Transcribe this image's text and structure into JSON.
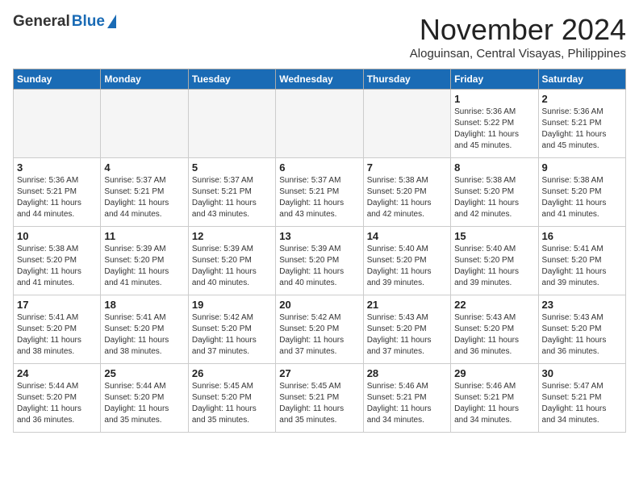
{
  "logo": {
    "general": "General",
    "blue": "Blue"
  },
  "header": {
    "month": "November 2024",
    "location": "Aloguinsan, Central Visayas, Philippines"
  },
  "weekdays": [
    "Sunday",
    "Monday",
    "Tuesday",
    "Wednesday",
    "Thursday",
    "Friday",
    "Saturday"
  ],
  "weeks": [
    [
      {
        "day": "",
        "info": ""
      },
      {
        "day": "",
        "info": ""
      },
      {
        "day": "",
        "info": ""
      },
      {
        "day": "",
        "info": ""
      },
      {
        "day": "",
        "info": ""
      },
      {
        "day": "1",
        "info": "Sunrise: 5:36 AM\nSunset: 5:22 PM\nDaylight: 11 hours\nand 45 minutes."
      },
      {
        "day": "2",
        "info": "Sunrise: 5:36 AM\nSunset: 5:21 PM\nDaylight: 11 hours\nand 45 minutes."
      }
    ],
    [
      {
        "day": "3",
        "info": "Sunrise: 5:36 AM\nSunset: 5:21 PM\nDaylight: 11 hours\nand 44 minutes."
      },
      {
        "day": "4",
        "info": "Sunrise: 5:37 AM\nSunset: 5:21 PM\nDaylight: 11 hours\nand 44 minutes."
      },
      {
        "day": "5",
        "info": "Sunrise: 5:37 AM\nSunset: 5:21 PM\nDaylight: 11 hours\nand 43 minutes."
      },
      {
        "day": "6",
        "info": "Sunrise: 5:37 AM\nSunset: 5:21 PM\nDaylight: 11 hours\nand 43 minutes."
      },
      {
        "day": "7",
        "info": "Sunrise: 5:38 AM\nSunset: 5:20 PM\nDaylight: 11 hours\nand 42 minutes."
      },
      {
        "day": "8",
        "info": "Sunrise: 5:38 AM\nSunset: 5:20 PM\nDaylight: 11 hours\nand 42 minutes."
      },
      {
        "day": "9",
        "info": "Sunrise: 5:38 AM\nSunset: 5:20 PM\nDaylight: 11 hours\nand 41 minutes."
      }
    ],
    [
      {
        "day": "10",
        "info": "Sunrise: 5:38 AM\nSunset: 5:20 PM\nDaylight: 11 hours\nand 41 minutes."
      },
      {
        "day": "11",
        "info": "Sunrise: 5:39 AM\nSunset: 5:20 PM\nDaylight: 11 hours\nand 41 minutes."
      },
      {
        "day": "12",
        "info": "Sunrise: 5:39 AM\nSunset: 5:20 PM\nDaylight: 11 hours\nand 40 minutes."
      },
      {
        "day": "13",
        "info": "Sunrise: 5:39 AM\nSunset: 5:20 PM\nDaylight: 11 hours\nand 40 minutes."
      },
      {
        "day": "14",
        "info": "Sunrise: 5:40 AM\nSunset: 5:20 PM\nDaylight: 11 hours\nand 39 minutes."
      },
      {
        "day": "15",
        "info": "Sunrise: 5:40 AM\nSunset: 5:20 PM\nDaylight: 11 hours\nand 39 minutes."
      },
      {
        "day": "16",
        "info": "Sunrise: 5:41 AM\nSunset: 5:20 PM\nDaylight: 11 hours\nand 39 minutes."
      }
    ],
    [
      {
        "day": "17",
        "info": "Sunrise: 5:41 AM\nSunset: 5:20 PM\nDaylight: 11 hours\nand 38 minutes."
      },
      {
        "day": "18",
        "info": "Sunrise: 5:41 AM\nSunset: 5:20 PM\nDaylight: 11 hours\nand 38 minutes."
      },
      {
        "day": "19",
        "info": "Sunrise: 5:42 AM\nSunset: 5:20 PM\nDaylight: 11 hours\nand 37 minutes."
      },
      {
        "day": "20",
        "info": "Sunrise: 5:42 AM\nSunset: 5:20 PM\nDaylight: 11 hours\nand 37 minutes."
      },
      {
        "day": "21",
        "info": "Sunrise: 5:43 AM\nSunset: 5:20 PM\nDaylight: 11 hours\nand 37 minutes."
      },
      {
        "day": "22",
        "info": "Sunrise: 5:43 AM\nSunset: 5:20 PM\nDaylight: 11 hours\nand 36 minutes."
      },
      {
        "day": "23",
        "info": "Sunrise: 5:43 AM\nSunset: 5:20 PM\nDaylight: 11 hours\nand 36 minutes."
      }
    ],
    [
      {
        "day": "24",
        "info": "Sunrise: 5:44 AM\nSunset: 5:20 PM\nDaylight: 11 hours\nand 36 minutes."
      },
      {
        "day": "25",
        "info": "Sunrise: 5:44 AM\nSunset: 5:20 PM\nDaylight: 11 hours\nand 35 minutes."
      },
      {
        "day": "26",
        "info": "Sunrise: 5:45 AM\nSunset: 5:20 PM\nDaylight: 11 hours\nand 35 minutes."
      },
      {
        "day": "27",
        "info": "Sunrise: 5:45 AM\nSunset: 5:21 PM\nDaylight: 11 hours\nand 35 minutes."
      },
      {
        "day": "28",
        "info": "Sunrise: 5:46 AM\nSunset: 5:21 PM\nDaylight: 11 hours\nand 34 minutes."
      },
      {
        "day": "29",
        "info": "Sunrise: 5:46 AM\nSunset: 5:21 PM\nDaylight: 11 hours\nand 34 minutes."
      },
      {
        "day": "30",
        "info": "Sunrise: 5:47 AM\nSunset: 5:21 PM\nDaylight: 11 hours\nand 34 minutes."
      }
    ]
  ]
}
